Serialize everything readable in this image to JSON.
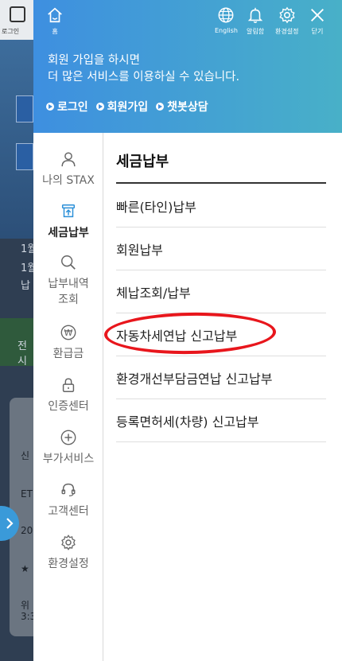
{
  "background": {
    "topleft_label": "로그인",
    "text_lines": [
      "1월",
      "1월",
      "납"
    ],
    "green_text": "전시",
    "panel_rows": [
      "신",
      "ET",
      "20",
      "★",
      "위",
      "3:3"
    ]
  },
  "header": {
    "icons": [
      {
        "name": "home-icon",
        "label": "홈"
      },
      {
        "name": "globe-icon",
        "label": "English"
      },
      {
        "name": "bell-icon",
        "label": "알림함"
      },
      {
        "name": "gear-icon",
        "label": "환경설정"
      },
      {
        "name": "close-icon",
        "label": "닫기"
      }
    ],
    "message_line1": "회원 가입을 하시면",
    "message_line2": "더 많은 서비스를 이용하실 수 있습니다.",
    "links": [
      "로그인",
      "회원가입",
      "챗봇상담"
    ]
  },
  "nav": [
    {
      "name": "person-icon",
      "label": "나의 STAX",
      "active": false
    },
    {
      "name": "payment-icon",
      "label": "세금납부",
      "active": true
    },
    {
      "name": "search-icon",
      "label": "납부내역\n조회",
      "active": false
    },
    {
      "name": "won-icon",
      "label": "환급금",
      "active": false
    },
    {
      "name": "lock-icon",
      "label": "인증센터",
      "active": false
    },
    {
      "name": "plus-circle-icon",
      "label": "부가서비스",
      "active": false
    },
    {
      "name": "headset-icon",
      "label": "고객센터",
      "active": false
    },
    {
      "name": "settings-icon",
      "label": "환경설정",
      "active": false
    }
  ],
  "content": {
    "title": "세금납부",
    "items": [
      "빠른(타인)납부",
      "회원납부",
      "체납조회/납부",
      "자동차세연납 신고납부",
      "환경개선부담금연납 신고납부",
      "등록면허세(차량) 신고납부"
    ]
  },
  "colors": {
    "header_start": "#3e8fe0",
    "header_end": "#48b0c8",
    "highlight": "#e8161c"
  }
}
